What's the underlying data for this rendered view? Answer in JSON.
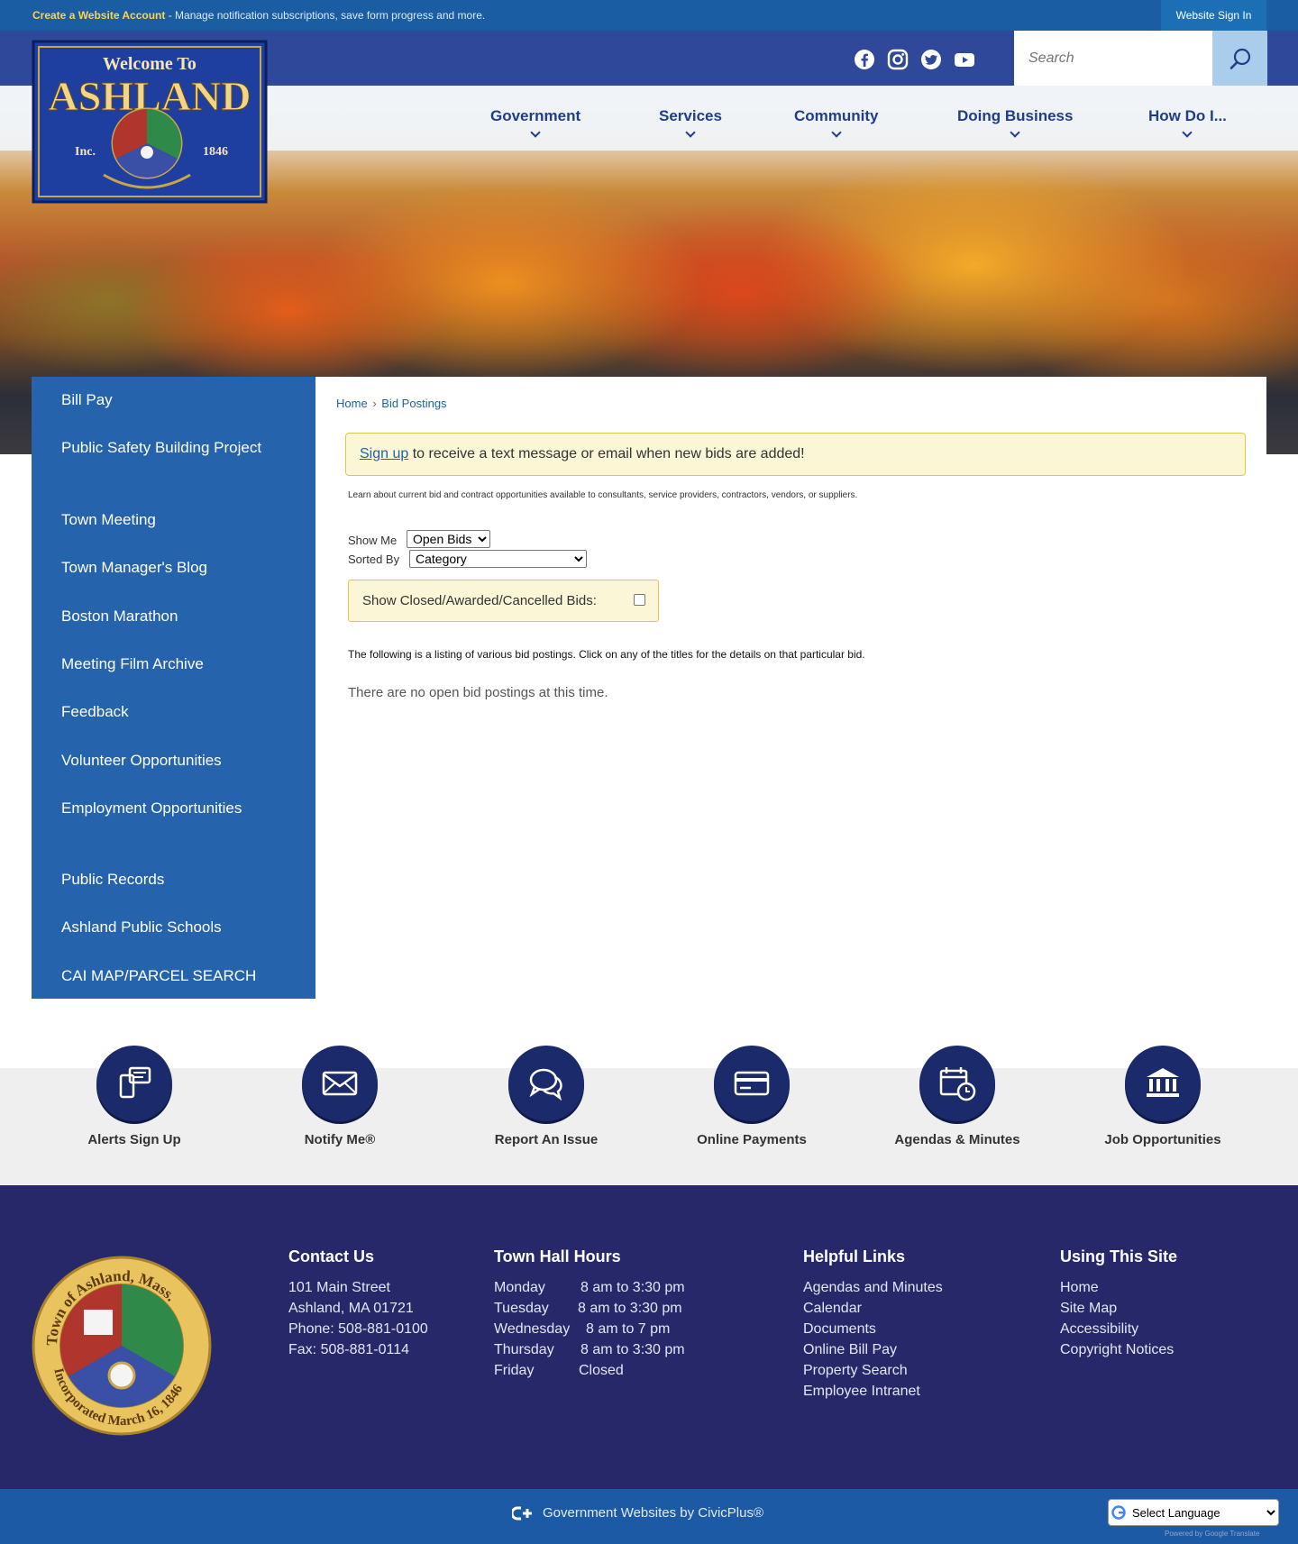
{
  "topbar": {
    "create_account": "Create a Website Account",
    "tagline": " - Manage notification subscriptions, save form progress and more.",
    "signin": "Website Sign In"
  },
  "logo": {
    "line1": "Welcome To",
    "line2": "ASHLAND",
    "inc": "Inc.",
    "year": "1846"
  },
  "social": [
    {
      "icon": "facebook-icon"
    },
    {
      "icon": "instagram-icon"
    },
    {
      "icon": "twitter-icon"
    },
    {
      "icon": "youtube-icon"
    }
  ],
  "search": {
    "placeholder": "Search"
  },
  "nav": [
    "Government",
    "Services",
    "Community",
    "Doing Business",
    "How Do I..."
  ],
  "sidebar": {
    "items": [
      "Bill Pay",
      "Public Safety Building Project",
      "Town Meeting",
      "Town Manager's Blog",
      "Boston Marathon",
      "Meeting Film Archive",
      "Feedback",
      "Volunteer Opportunities",
      "Employment Opportunities",
      "Public Records",
      "Ashland Public Schools",
      "CAI MAP/PARCEL SEARCH"
    ]
  },
  "breadcrumb": {
    "home": "Home",
    "sep": "›",
    "current": "Bid Postings"
  },
  "alert": {
    "link": "Sign up",
    "text": " to receive a text message or email when new bids are added!"
  },
  "intro": "Learn about current bid and contract opportunities available to consultants, service providers, contractors, vendors, or suppliers.",
  "filters": {
    "show_me_label": "Show Me",
    "show_me_value": "Open Bids",
    "sorted_by_label": "Sorted By",
    "sorted_by_value": "Category",
    "closed_label": "Show Closed/Awarded/Cancelled Bids:"
  },
  "listing_text": "The following is a listing of various bid postings. Click on any of the titles for the details on that particular bid.",
  "empty_text": "There are no open bid postings at this time.",
  "quick_links": [
    {
      "label": "Alerts Sign Up",
      "icon": "mobile-alert-icon"
    },
    {
      "label": "Notify Me®",
      "icon": "envelope-icon"
    },
    {
      "label": "Report An Issue",
      "icon": "chat-bubbles-icon"
    },
    {
      "label": "Online Payments",
      "icon": "credit-card-icon"
    },
    {
      "label": "Agendas & Minutes",
      "icon": "calendar-clock-icon"
    },
    {
      "label": "Job Opportunities",
      "icon": "building-columns-icon"
    }
  ],
  "seal": {
    "top_text": "Town of Ashland, Mass.",
    "bottom_text": "Incorporated March 16, 1846"
  },
  "footer": {
    "contact": {
      "title": "Contact Us",
      "lines": [
        "101 Main Street",
        "Ashland, MA 01721",
        "Phone: 508-881-0100",
        "Fax: 508-881-0114"
      ]
    },
    "hours": {
      "title": "Town Hall Hours",
      "rows": [
        {
          "day": "Monday",
          "time": "8 am to 3:30 pm"
        },
        {
          "day": "Tuesday",
          "time": "8 am to 3:30 pm"
        },
        {
          "day": "Wednesday",
          "time": "8 am to 7 pm"
        },
        {
          "day": "Thursday",
          "time": "8 am to 3:30 pm"
        },
        {
          "day": "Friday",
          "time": "Closed"
        }
      ]
    },
    "helpful": {
      "title": "Helpful Links",
      "links": [
        "Agendas and Minutes",
        "Calendar",
        "Documents",
        "Online Bill Pay",
        "Property Search",
        "Employee Intranet"
      ]
    },
    "using": {
      "title": "Using This Site",
      "links": [
        "Home",
        "Site Map",
        "Accessibility",
        "Copyright Notices"
      ]
    }
  },
  "bottom": {
    "powered": "Government Websites by CivicPlus®",
    "language": "Select Language",
    "translate": "Powered by Google Translate"
  },
  "colors": {
    "top_blue": "#1a5da3",
    "nav_text": "#1f3d8a",
    "sidebar": "#2563ad",
    "footer": "#26286a",
    "alert_bg": "#fbf6d5"
  }
}
